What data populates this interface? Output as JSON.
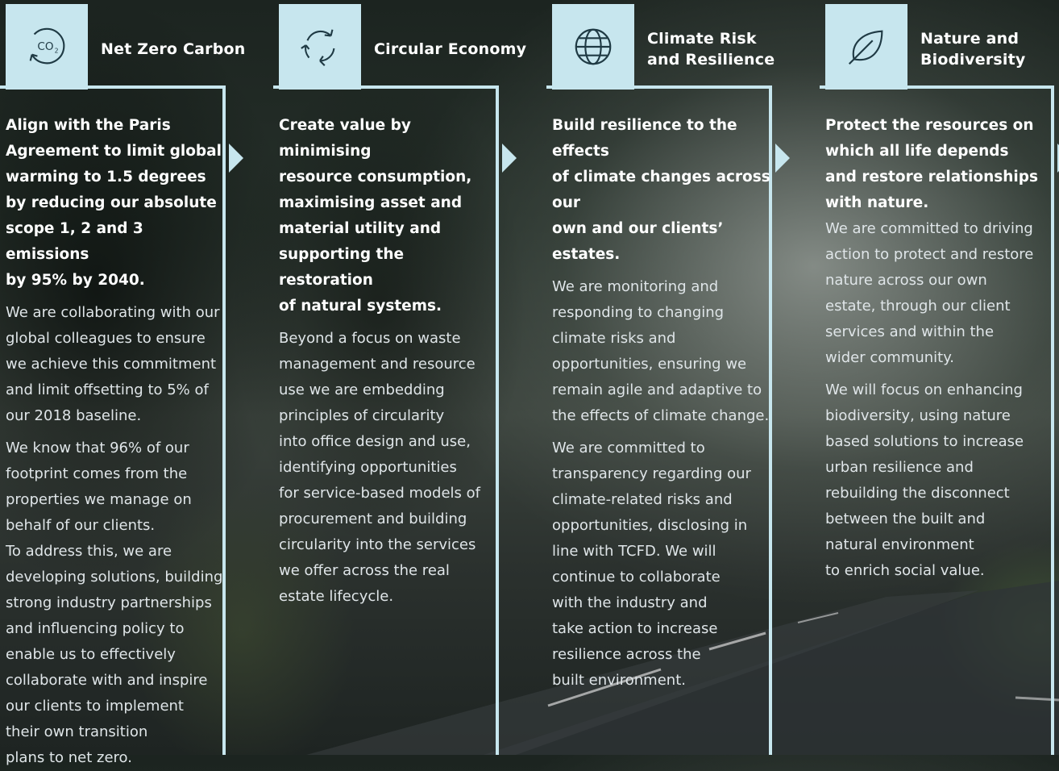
{
  "columns": [
    {
      "icon": "co2-icon",
      "title": "Net Zero Carbon",
      "lead": "Align with the Paris\nAgreement to limit global\nwarming to 1.5 degrees\nby reducing our absolute\nscope 1, 2 and 3 emissions\nby 95% by 2040.",
      "paragraphs": [
        " We are collaborating with our\nglobal colleagues to ensure\nwe achieve this commitment\nand limit offsetting to 5% of\nour 2018 baseline.",
        "We know that 96% of our\nfootprint comes from the\nproperties we manage on\nbehalf of our clients.",
        "To address this, we are\ndeveloping solutions, building\nstrong industry partnerships\nand influencing policy to\nenable us to effectively\ncollaborate with and inspire\nour clients to implement\ntheir own transition\nplans to net zero."
      ]
    },
    {
      "icon": "recycle-arrows-icon",
      "title": "Circular Economy",
      "lead": "Create value by minimising\nresource consumption,\nmaximising asset and\nmaterial utility and\nsupporting the restoration\nof natural systems.",
      "paragraphs": [
        "Beyond a focus on waste\nmanagement and resource\nuse we are embedding\nprinciples of circularity\ninto office design and use,\nidentifying opportunities\nfor service-based models of\nprocurement and building\ncircularity into the services\nwe offer across the real\nestate lifecycle."
      ]
    },
    {
      "icon": "globe-icon",
      "title": "Climate Risk\nand Resilience",
      "lead": "Build resilience to the effects\nof climate changes across our\nown and our clients’ estates.",
      "paragraphs": [
        "We are monitoring and\nresponding to changing\nclimate risks and\nopportunities, ensuring we\nremain agile and adaptive to\nthe effects of climate change.",
        "We are committed to\ntransparency regarding our\nclimate-related risks and\nopportunities, disclosing in\nline with  TCFD. We will\ncontinue to collaborate\nwith the industry and\ntake action to increase\nresilience across the\nbuilt environment."
      ]
    },
    {
      "icon": "leaf-icon",
      "title": "Nature and\nBiodiversity",
      "lead": "Protect the resources on\nwhich all life depends\nand restore relationships\nwith nature.",
      "paragraphs": [
        "We are committed to driving\naction to  protect and restore\nnature across our own\nestate, through our client\nservices and within the\nwider community.",
        "We will focus on enhancing\nbiodiversity, using nature\nbased solutions to increase\nurban resilience and\nrebuilding the disconnect\nbetween the built and\nnatural environment\nto enrich social value."
      ]
    }
  ],
  "colors": {
    "accent": "#c7e6ee",
    "text": "#ffffff",
    "body_text": "#dfe5e8"
  }
}
